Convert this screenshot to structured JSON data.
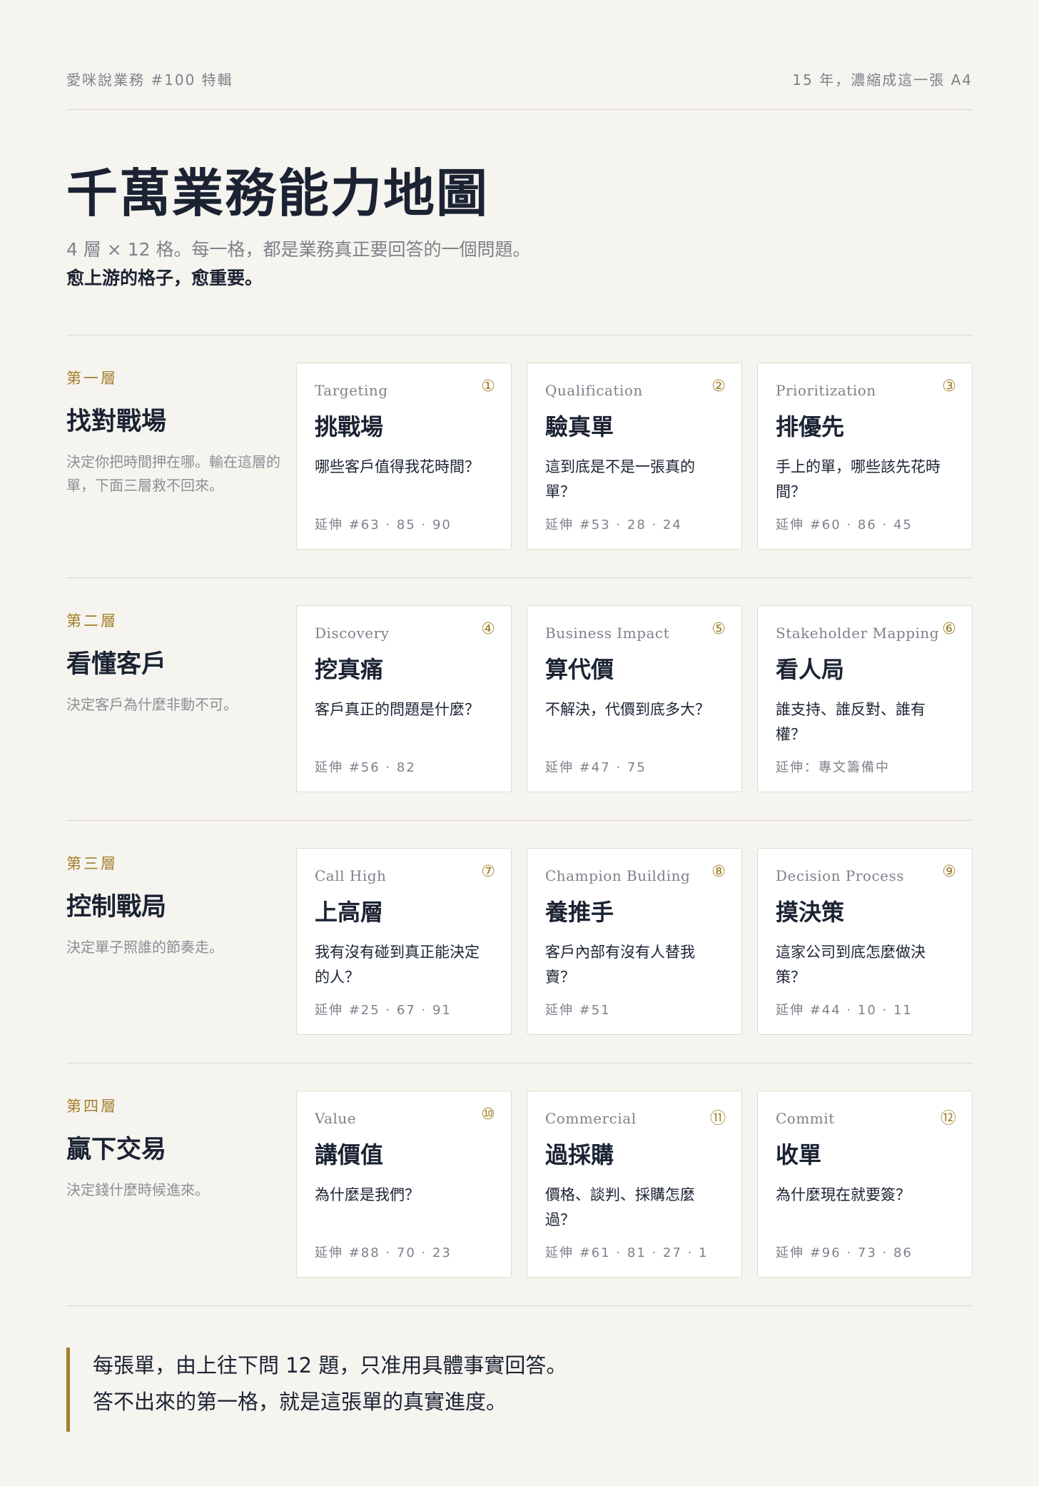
{
  "header": {
    "left": "愛咪說業務 #100 特輯",
    "right": "15 年，濃縮成這一張 A4"
  },
  "title": "千萬業務能力地圖",
  "subtitle": "4 層 × 12 格。每一格，都是業務真正要回答的一個問題。",
  "emphasis": "愈上游的格子，愈重要。",
  "layers": [
    {
      "num": "第一層",
      "name": "找對戰場",
      "desc": "決定你把時間押在哪。輸在這層的單，下面三層救不回來。",
      "cards": [
        {
          "en": "Targeting",
          "idx": "①",
          "zh": "挑戰場",
          "q": "哪些客戶值得我花時間？",
          "ext": "延伸 #63 · 85 · 90"
        },
        {
          "en": "Qualification",
          "idx": "②",
          "zh": "驗真單",
          "q": "這到底是不是一張真的單？",
          "ext": "延伸 #53 · 28 · 24"
        },
        {
          "en": "Prioritization",
          "idx": "③",
          "zh": "排優先",
          "q": "手上的單，哪些該先花時間？",
          "ext": "延伸 #60 · 86 · 45"
        }
      ]
    },
    {
      "num": "第二層",
      "name": "看懂客戶",
      "desc": "決定客戶為什麼非動不可。",
      "cards": [
        {
          "en": "Discovery",
          "idx": "④",
          "zh": "挖真痛",
          "q": "客戶真正的問題是什麼？",
          "ext": "延伸 #56 · 82"
        },
        {
          "en": "Business Impact",
          "idx": "⑤",
          "zh": "算代價",
          "q": "不解決，代價到底多大？",
          "ext": "延伸 #47 · 75"
        },
        {
          "en": "Stakeholder Mapping",
          "idx": "⑥",
          "zh": "看人局",
          "q": "誰支持、誰反對、誰有權？",
          "ext": "延伸：專文籌備中"
        }
      ]
    },
    {
      "num": "第三層",
      "name": "控制戰局",
      "desc": "決定單子照誰的節奏走。",
      "cards": [
        {
          "en": "Call High",
          "idx": "⑦",
          "zh": "上高層",
          "q": "我有沒有碰到真正能決定的人？",
          "ext": "延伸 #25 · 67 · 91"
        },
        {
          "en": "Champion Building",
          "idx": "⑧",
          "zh": "養推手",
          "q": "客戶內部有沒有人替我賣？",
          "ext": "延伸 #51"
        },
        {
          "en": "Decision Process",
          "idx": "⑨",
          "zh": "摸決策",
          "q": "這家公司到底怎麼做決策？",
          "ext": "延伸 #44 · 10 · 11"
        }
      ]
    },
    {
      "num": "第四層",
      "name": "贏下交易",
      "desc": "決定錢什麼時候進來。",
      "cards": [
        {
          "en": "Value",
          "idx": "⑩",
          "zh": "講價值",
          "q": "為什麼是我們？",
          "ext": "延伸 #88 · 70 · 23"
        },
        {
          "en": "Commercial",
          "idx": "⑪",
          "zh": "過採購",
          "q": "價格、談判、採購怎麼過？",
          "ext": "延伸 #61 · 81 · 27 · 1"
        },
        {
          "en": "Commit",
          "idx": "⑫",
          "zh": "收單",
          "q": "為什麼現在就要簽？",
          "ext": "延伸 #96 · 73 · 86"
        }
      ]
    }
  ],
  "footer": {
    "line1": "每張單，由上往下問 12 題，只准用具體事實回答。",
    "line2": "答不出來的第一格，就是這張單的真實進度。"
  }
}
